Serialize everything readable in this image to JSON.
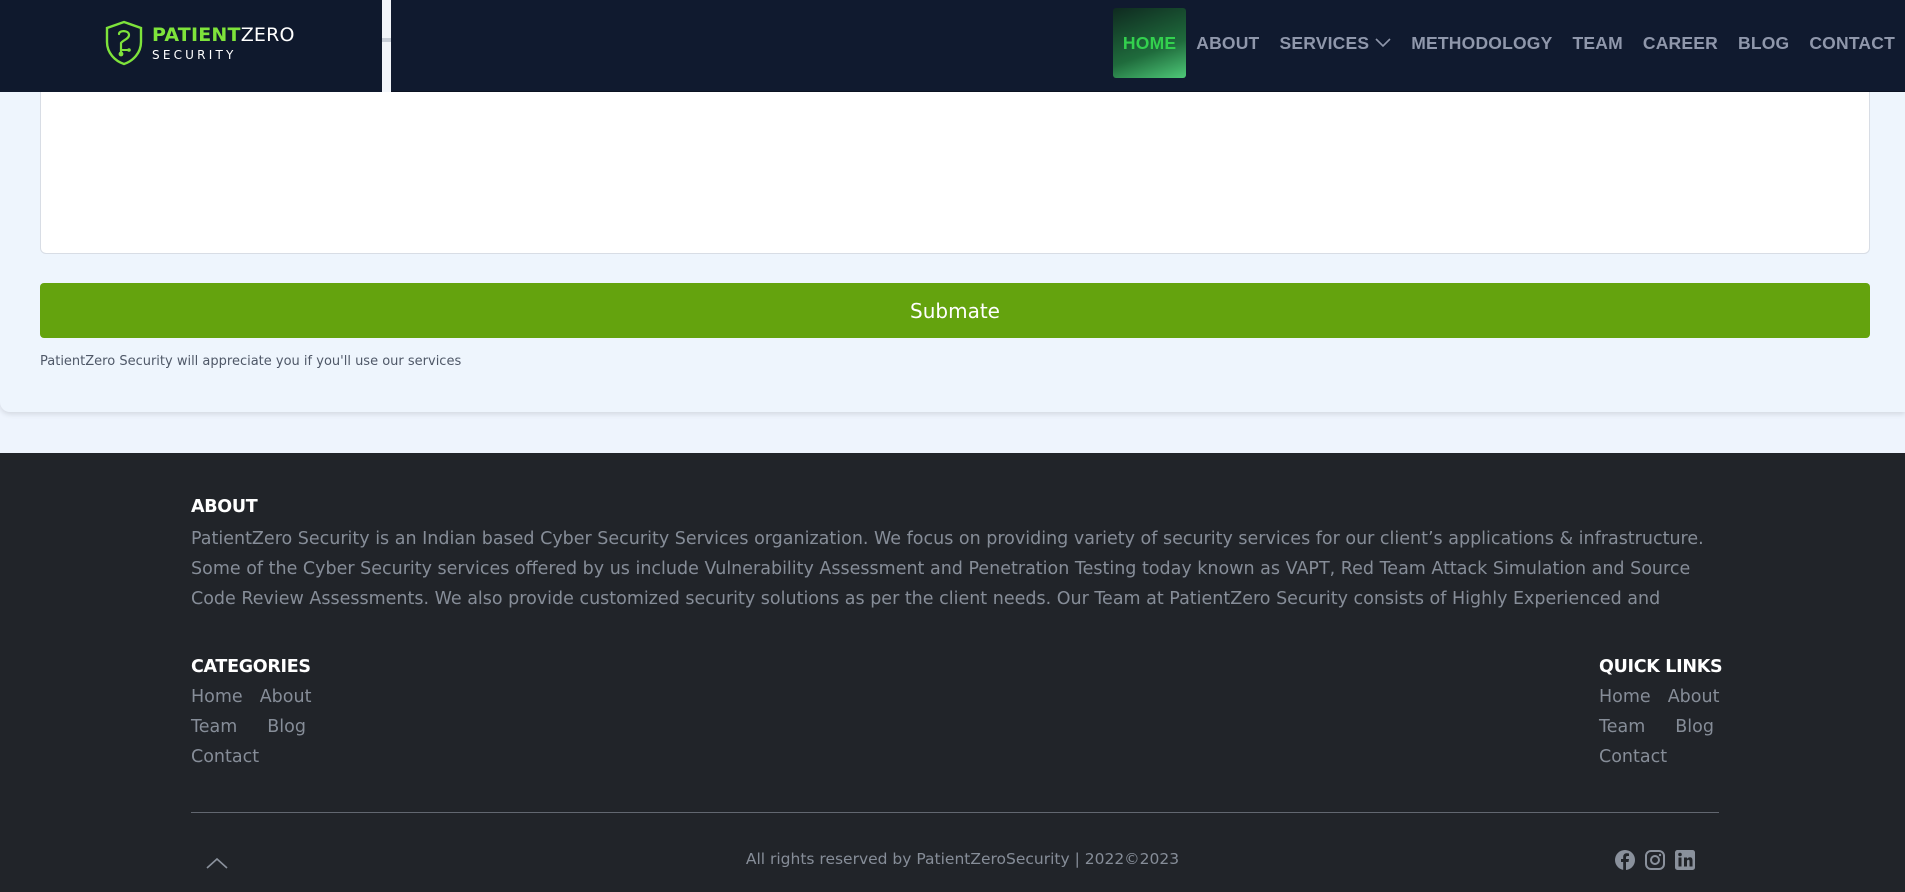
{
  "header": {
    "logo": {
      "name_part1": "PATIENT",
      "name_part2": "ZERO",
      "subtitle": "SECURITY"
    },
    "nav": [
      {
        "label": "HOME",
        "active": true
      },
      {
        "label": "ABOUT"
      },
      {
        "label": "SERVICES",
        "has_dropdown": true
      },
      {
        "label": "METHODOLOGY"
      },
      {
        "label": "TEAM"
      },
      {
        "label": "CAREER"
      },
      {
        "label": "BLOG"
      },
      {
        "label": "CONTACT"
      }
    ]
  },
  "form": {
    "message_value": "",
    "submit_label": "Submate",
    "note": "PatientZero Security will appreciate you if you'll use our services"
  },
  "footer": {
    "about_heading": "ABOUT",
    "about_text": "PatientZero Security is an Indian based Cyber Security Services organization. We focus on providing variety of security services for our client’s applications & infrastructure. Some of the Cyber Security services offered by us include Vulnerability Assessment and Penetration Testing today known as VAPT, Red Team Attack Simulation and Source Code Review Assessments. We also provide customized security solutions as per the client needs. Our Team at PatientZero Security consists of Highly Experienced and",
    "categories_heading": "CATEGORIES",
    "categories": {
      "home": "Home",
      "about": "About",
      "team": "Team",
      "blog": "Blog",
      "contact": "Contact"
    },
    "quick_links_heading": "QUICK LINKS",
    "quick_links": {
      "home": "Home",
      "about": "About",
      "team": "Team",
      "blog": "Blog",
      "contact": "Contact"
    },
    "copyright": "All rights reserved by PatientZeroSecurity | 2022©2023",
    "social": [
      "facebook-icon",
      "instagram-icon",
      "linkedin-icon"
    ]
  },
  "colors": {
    "header_bg": "#101a2f",
    "accent_green": "#7ee33b",
    "submit_green": "#64a30e",
    "footer_bg": "#212429"
  }
}
